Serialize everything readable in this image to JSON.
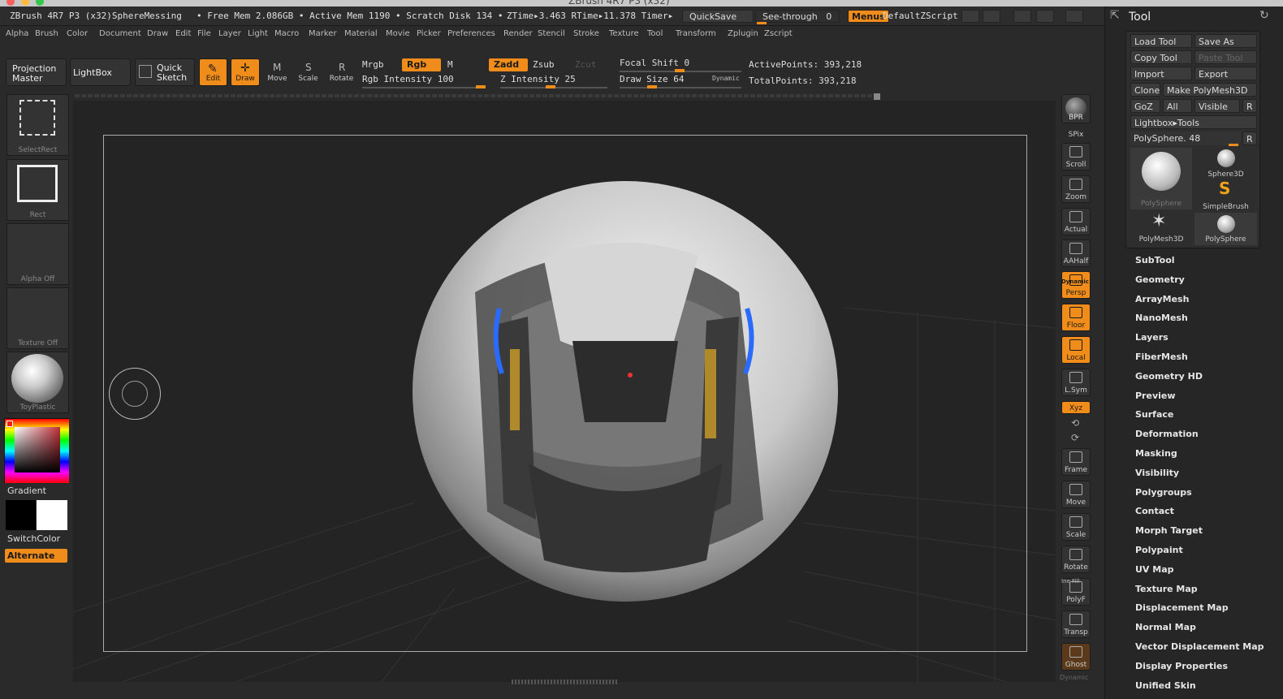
{
  "window": {
    "title": "ZBrush 4R7 P3 (x32)"
  },
  "status": {
    "app": "ZBrush 4R7 P3 (x32)SphereMessing",
    "mem": "• Free Mem 2.086GB • Active Mem 1190 • Scratch Disk 134 •",
    "time": "ZTime▸3.463 RTime▸11.378 Timer▸",
    "quicksave": "QuickSave",
    "seethrough": "See-through",
    "seethrough_value": "0",
    "menus": "Menus",
    "script": "DefaultZScript"
  },
  "menus": [
    "Alpha",
    "Brush",
    "Color",
    "Document",
    "Draw",
    "Edit",
    "File",
    "Layer",
    "Light",
    "Macro",
    "Marker",
    "Material",
    "Movie",
    "Picker",
    "Preferences",
    "Render",
    "Stencil",
    "Stroke",
    "Texture",
    "Tool",
    "Transform",
    "Zplugin",
    "Zscript"
  ],
  "toolbar": {
    "projection_master": [
      "Projection",
      "Master"
    ],
    "lightbox": "LightBox",
    "quick_sketch": [
      "Quick",
      "Sketch"
    ],
    "edit": "Edit",
    "draw": "Draw",
    "move": "Move",
    "scale": "Scale",
    "rotate": "Rotate",
    "mrgb": "Mrgb",
    "rgb": "Rgb",
    "m": "M",
    "zadd": "Zadd",
    "zsub": "Zsub",
    "zcut": "Zcut",
    "rgb_intensity": "Rgb Intensity 100",
    "z_intensity": "Z Intensity 25",
    "focal_shift": "Focal Shift 0",
    "draw_size": "Draw Size 64",
    "dynamic": "Dynamic",
    "active_points": "ActivePoints: 393,218",
    "total_points": "TotalPoints: 393,218"
  },
  "leftshelf": {
    "select_rect": "SelectRect",
    "rect": "Rect",
    "alpha_off": "Alpha  Off",
    "texture_off": "Texture  Off",
    "material": "ToyPlastic",
    "gradient": "Gradient",
    "switch_color": "SwitchColor",
    "alternate": "Alternate"
  },
  "rightshelf": [
    "BPR",
    "SPix",
    "Scroll",
    "Zoom",
    "Actual",
    "AAHalf",
    "Persp",
    "Floor",
    "Local",
    "L.Sym",
    "Xyz",
    "Frame",
    "Move",
    "Scale",
    "Rotate",
    "PolyF",
    "Transp",
    "Ghost"
  ],
  "rightshelf_extra": {
    "dynamic": "Dynamic",
    "line_fill": "Ine Fill"
  },
  "toolpanel": {
    "title": "Tool",
    "load_tool": "Load Tool",
    "save_as": "Save As",
    "copy_tool": "Copy Tool",
    "paste_tool": "Paste Tool",
    "import": "Import",
    "export": "Export",
    "clone": "Clone",
    "make_polymesh": "Make PolyMesh3D",
    "goz": "GoZ",
    "all": "All",
    "visible": "Visible",
    "r": "R",
    "lightbox_tools": "Lightbox▸Tools",
    "current_tool": "PolySphere. 48",
    "thumbs": [
      "PolySphere",
      "Sphere3D",
      "SimpleBrush",
      "PolyMesh3D",
      "PolySphere"
    ],
    "sections": [
      "SubTool",
      "Geometry",
      "ArrayMesh",
      "NanoMesh",
      "Layers",
      "FiberMesh",
      "Geometry HD",
      "Preview",
      "Surface",
      "Deformation",
      "Masking",
      "Visibility",
      "Polygroups",
      "Contact",
      "Morph Target",
      "Polypaint",
      "UV Map",
      "Texture Map",
      "Displacement Map",
      "Normal Map",
      "Vector Displacement Map",
      "Display Properties",
      "Unified Skin"
    ]
  },
  "colors": {
    "accent": "#f08c1a",
    "bg": "#2a2a2a",
    "viewport": "#242424"
  }
}
